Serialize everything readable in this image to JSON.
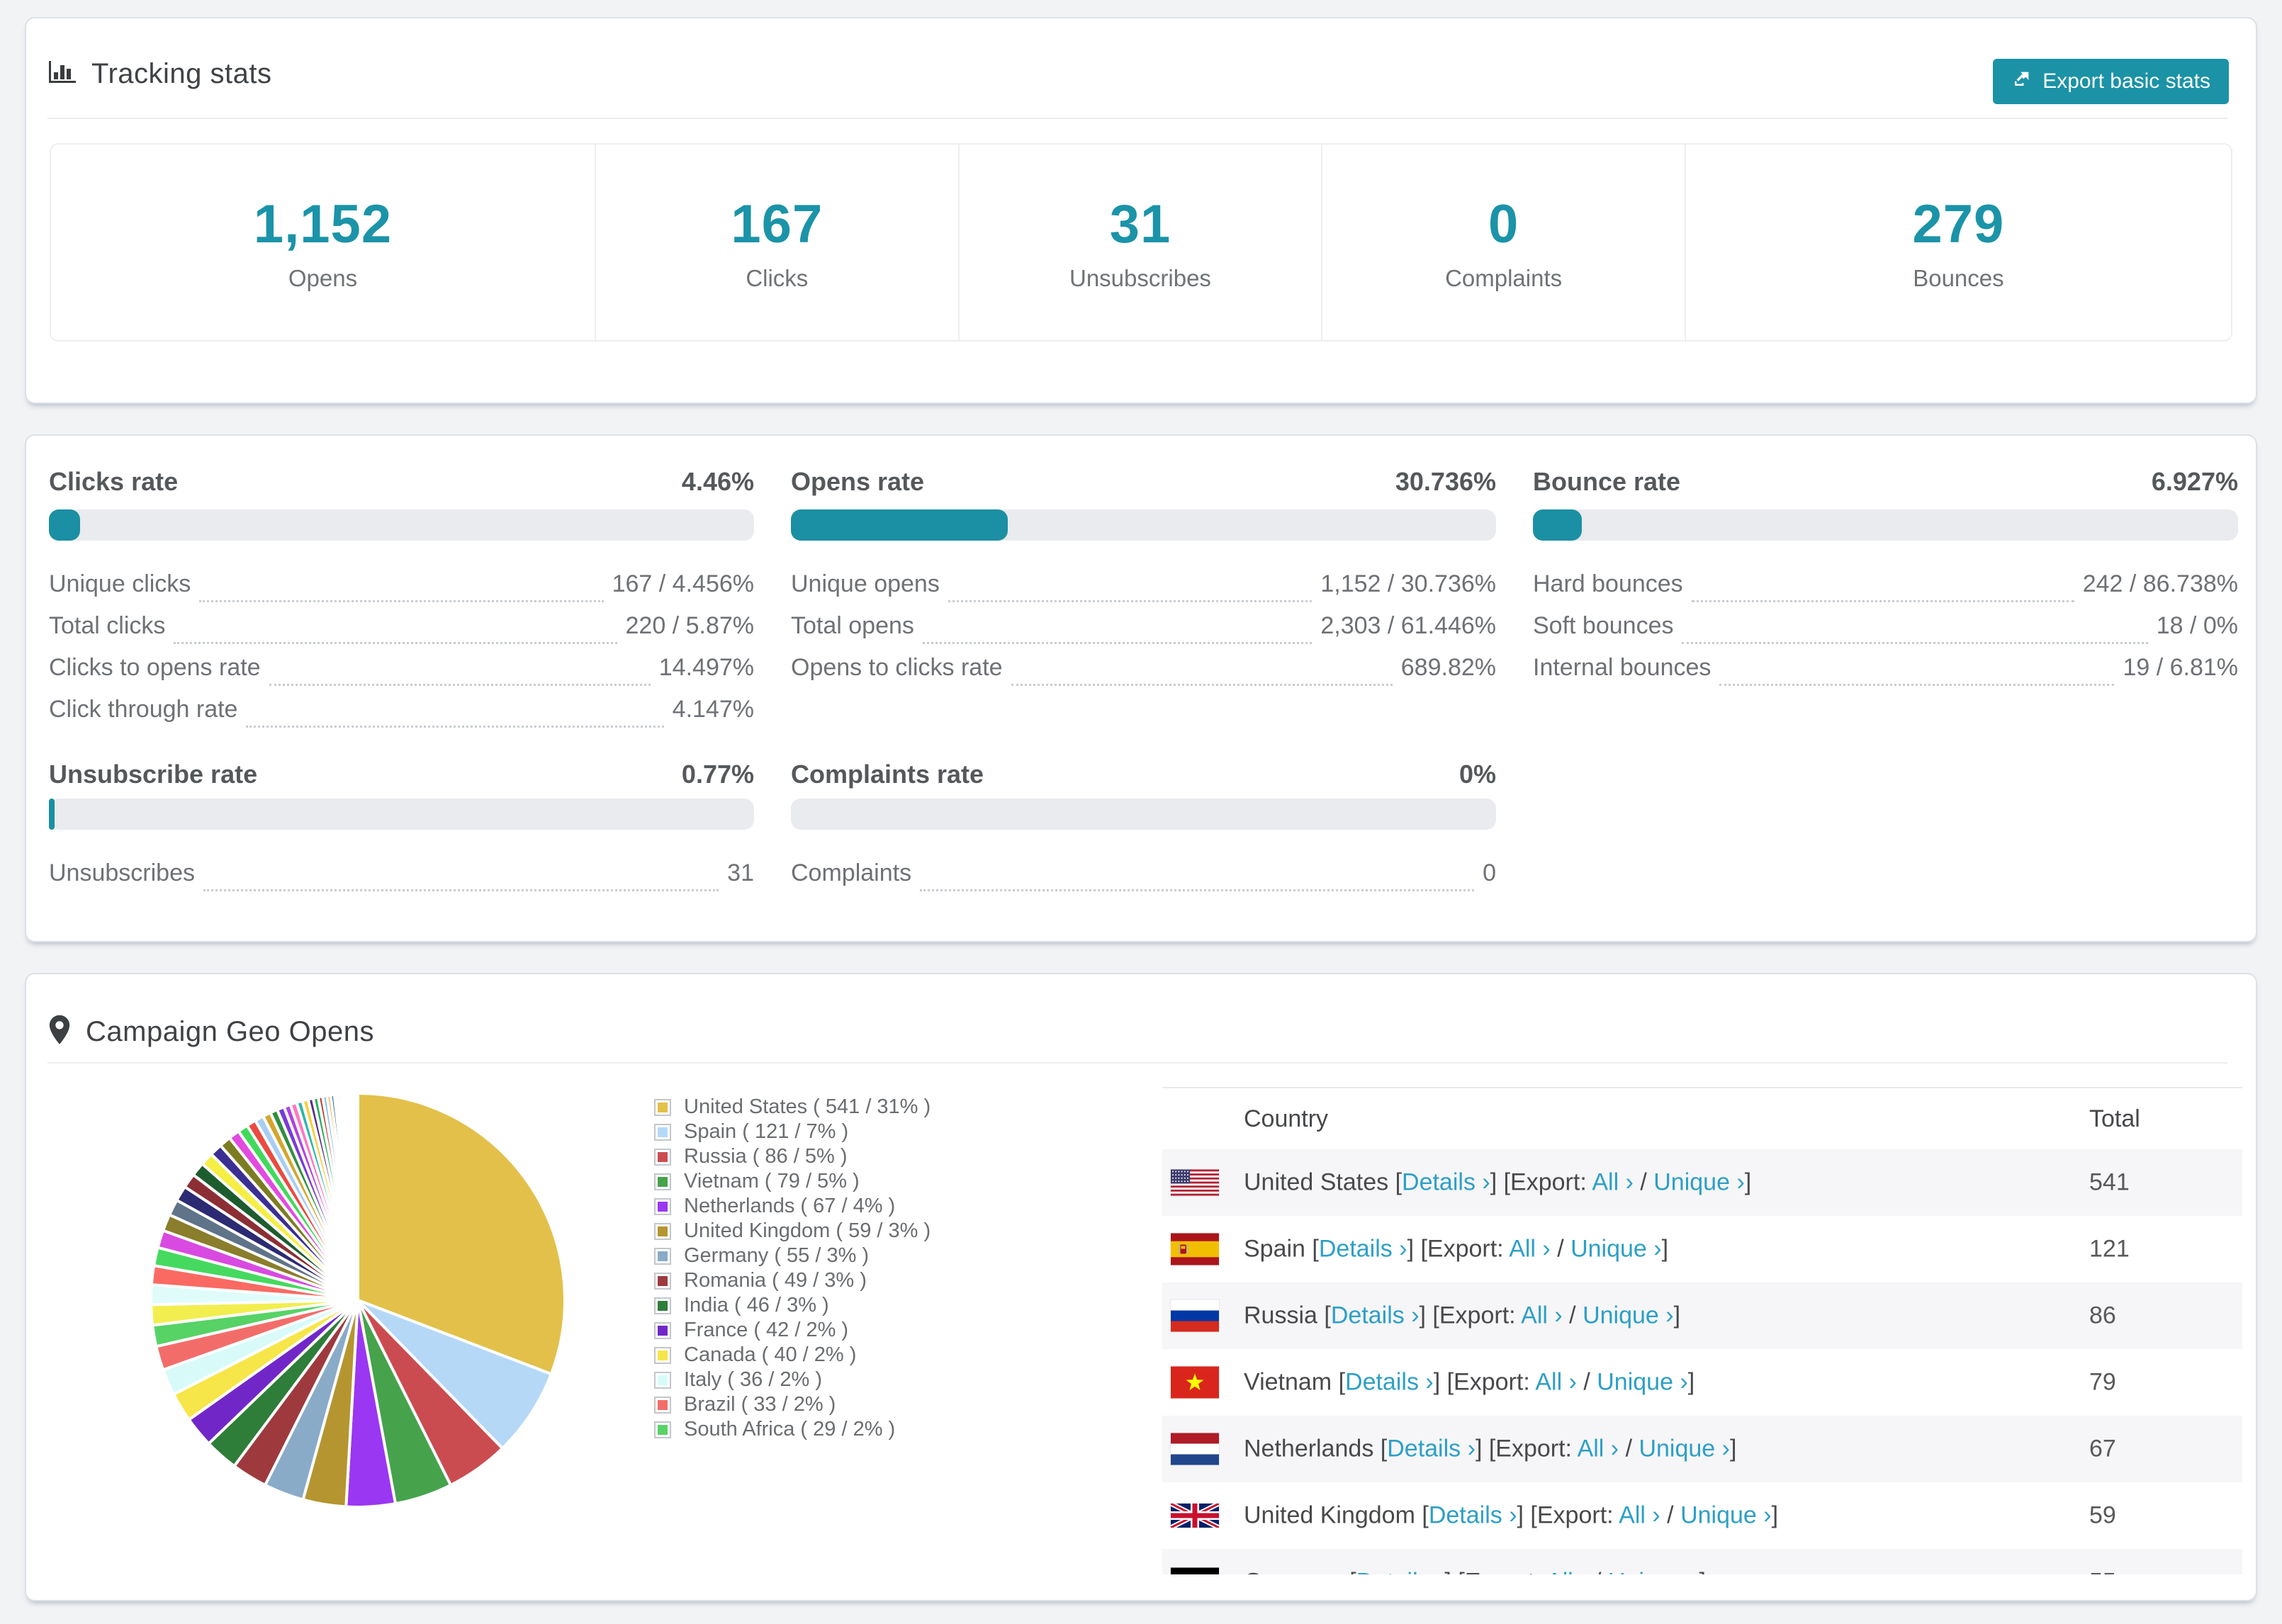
{
  "page_bg": "#f2f3f5",
  "accent": "#1b92a6",
  "link_color": "#2d9fc6",
  "tracking_stats": {
    "title": "Tracking stats",
    "export_button_label": "Export basic stats",
    "summary": [
      {
        "value": "1,152",
        "label": "Opens"
      },
      {
        "value": "167",
        "label": "Clicks"
      },
      {
        "value": "31",
        "label": "Unsubscribes"
      },
      {
        "value": "0",
        "label": "Complaints"
      },
      {
        "value": "279",
        "label": "Bounces"
      }
    ]
  },
  "rates": [
    {
      "title": "Clicks rate",
      "value": "4.46%",
      "percent": 4.46,
      "rows": [
        {
          "label": "Unique clicks",
          "value": "167 / 4.456%"
        },
        {
          "label": "Total clicks",
          "value": "220 / 5.87%"
        },
        {
          "label": "Clicks to opens rate",
          "value": "14.497%"
        },
        {
          "label": "Click through rate",
          "value": "4.147%"
        }
      ]
    },
    {
      "title": "Opens rate",
      "value": "30.736%",
      "percent": 30.736,
      "rows": [
        {
          "label": "Unique opens",
          "value": "1,152 / 30.736%"
        },
        {
          "label": "Total opens",
          "value": "2,303 / 61.446%"
        },
        {
          "label": "Opens to clicks rate",
          "value": "689.82%"
        }
      ]
    },
    {
      "title": "Bounce rate",
      "value": "6.927%",
      "percent": 6.927,
      "rows": [
        {
          "label": "Hard bounces",
          "value": "242 / 86.738%"
        },
        {
          "label": "Soft bounces",
          "value": "18 / 0%"
        },
        {
          "label": "Internal bounces",
          "value": "19 / 6.81%"
        }
      ]
    },
    {
      "title": "Unsubscribe rate",
      "value": "0.77%",
      "percent": 0.77,
      "rows": [
        {
          "label": "Unsubscribes",
          "value": "31"
        }
      ]
    },
    {
      "title": "Complaints rate",
      "value": "0%",
      "percent": 0,
      "rows": [
        {
          "label": "Complaints",
          "value": "0"
        }
      ]
    }
  ],
  "geo": {
    "title": "Campaign Geo Opens",
    "table": {
      "country_header": "Country",
      "total_header": "Total",
      "details_label": "Details ›",
      "export_label": "Export:",
      "all_label": "All ›",
      "unique_label": "Unique ›"
    },
    "countries": [
      {
        "name": "United States",
        "total": 541,
        "pct": "31%",
        "color": "#e2c04a",
        "flag": "us"
      },
      {
        "name": "Spain",
        "total": 121,
        "pct": "7%",
        "color": "#b5d8f7",
        "flag": "es"
      },
      {
        "name": "Russia",
        "total": 86,
        "pct": "5%",
        "color": "#cb4c50",
        "flag": "ru"
      },
      {
        "name": "Vietnam",
        "total": 79,
        "pct": "5%",
        "color": "#46a34c",
        "flag": "vn"
      },
      {
        "name": "Netherlands",
        "total": 67,
        "pct": "4%",
        "color": "#9a37f2",
        "flag": "nl"
      },
      {
        "name": "United Kingdom",
        "total": 59,
        "pct": "3%",
        "color": "#b5952f",
        "flag": "gb"
      },
      {
        "name": "Germany",
        "total": 55,
        "pct": "3%",
        "color": "#89abc8",
        "flag": "de"
      },
      {
        "name": "Romania",
        "total": 49,
        "pct": "3%",
        "color": "#9e3a3e"
      },
      {
        "name": "India",
        "total": 46,
        "pct": "3%",
        "color": "#2e7d39"
      },
      {
        "name": "France",
        "total": 42,
        "pct": "2%",
        "color": "#7127c8"
      },
      {
        "name": "Canada",
        "total": 40,
        "pct": "2%",
        "color": "#f6e649"
      },
      {
        "name": "Italy",
        "total": 36,
        "pct": "2%",
        "color": "#d8fbfa"
      },
      {
        "name": "Brazil",
        "total": 33,
        "pct": "2%",
        "color": "#f26d6a"
      },
      {
        "name": "South Africa",
        "total": 29,
        "pct": "2%",
        "color": "#57d265"
      }
    ],
    "table_rows_visible": 7
  },
  "chart_data": {
    "type": "pie",
    "title": "Campaign Geo Opens",
    "legend_position": "right",
    "labels": [
      "United States",
      "Spain",
      "Russia",
      "Vietnam",
      "Netherlands",
      "United Kingdom",
      "Germany",
      "Romania",
      "India",
      "France",
      "Canada",
      "Italy",
      "Brazil",
      "South Africa"
    ],
    "values": [
      541,
      121,
      86,
      79,
      67,
      59,
      55,
      49,
      46,
      42,
      40,
      36,
      33,
      29
    ],
    "other_slices": {
      "values": [
        28,
        27,
        26,
        25,
        24,
        23,
        22,
        21,
        20,
        19,
        18,
        17,
        16,
        15,
        14,
        13,
        12,
        11,
        10,
        10,
        9,
        9,
        8,
        8,
        7,
        7,
        6,
        6,
        5,
        5,
        4,
        4,
        3,
        3,
        3,
        2,
        2,
        2,
        2,
        1,
        1,
        1,
        1,
        1,
        1,
        1
      ],
      "colors": [
        "#f2ee4f",
        "#dffcfa",
        "#fa6a63",
        "#46d95f",
        "#d84ae0",
        "#8a7d2b",
        "#5f7488",
        "#2c2a72",
        "#8c2f35",
        "#1d5c2e",
        "#f5ee45",
        "#3b2f92",
        "#7c7c22",
        "#e24ae0",
        "#41d95c",
        "#ea4a41",
        "#a9cdf2",
        "#d2a62e",
        "#2f8f3e",
        "#7a3bd6",
        "#b044e0",
        "#ff78c1",
        "#29b7a8",
        "#f4d03f",
        "#5b2c86",
        "#27ae60",
        "#c0392b",
        "#85c1e9",
        "#f39c12",
        "#1f618d",
        "#7dcea0",
        "#d98880",
        "#a569bd",
        "#f7dc6f",
        "#45b39d",
        "#dc7633",
        "#5d6d7e",
        "#e74c3c",
        "#58d68d",
        "#af7ac5",
        "#f1948a",
        "#73c6b6",
        "#f0b27a",
        "#808b96",
        "#6c3483",
        "#117a65"
      ]
    }
  }
}
